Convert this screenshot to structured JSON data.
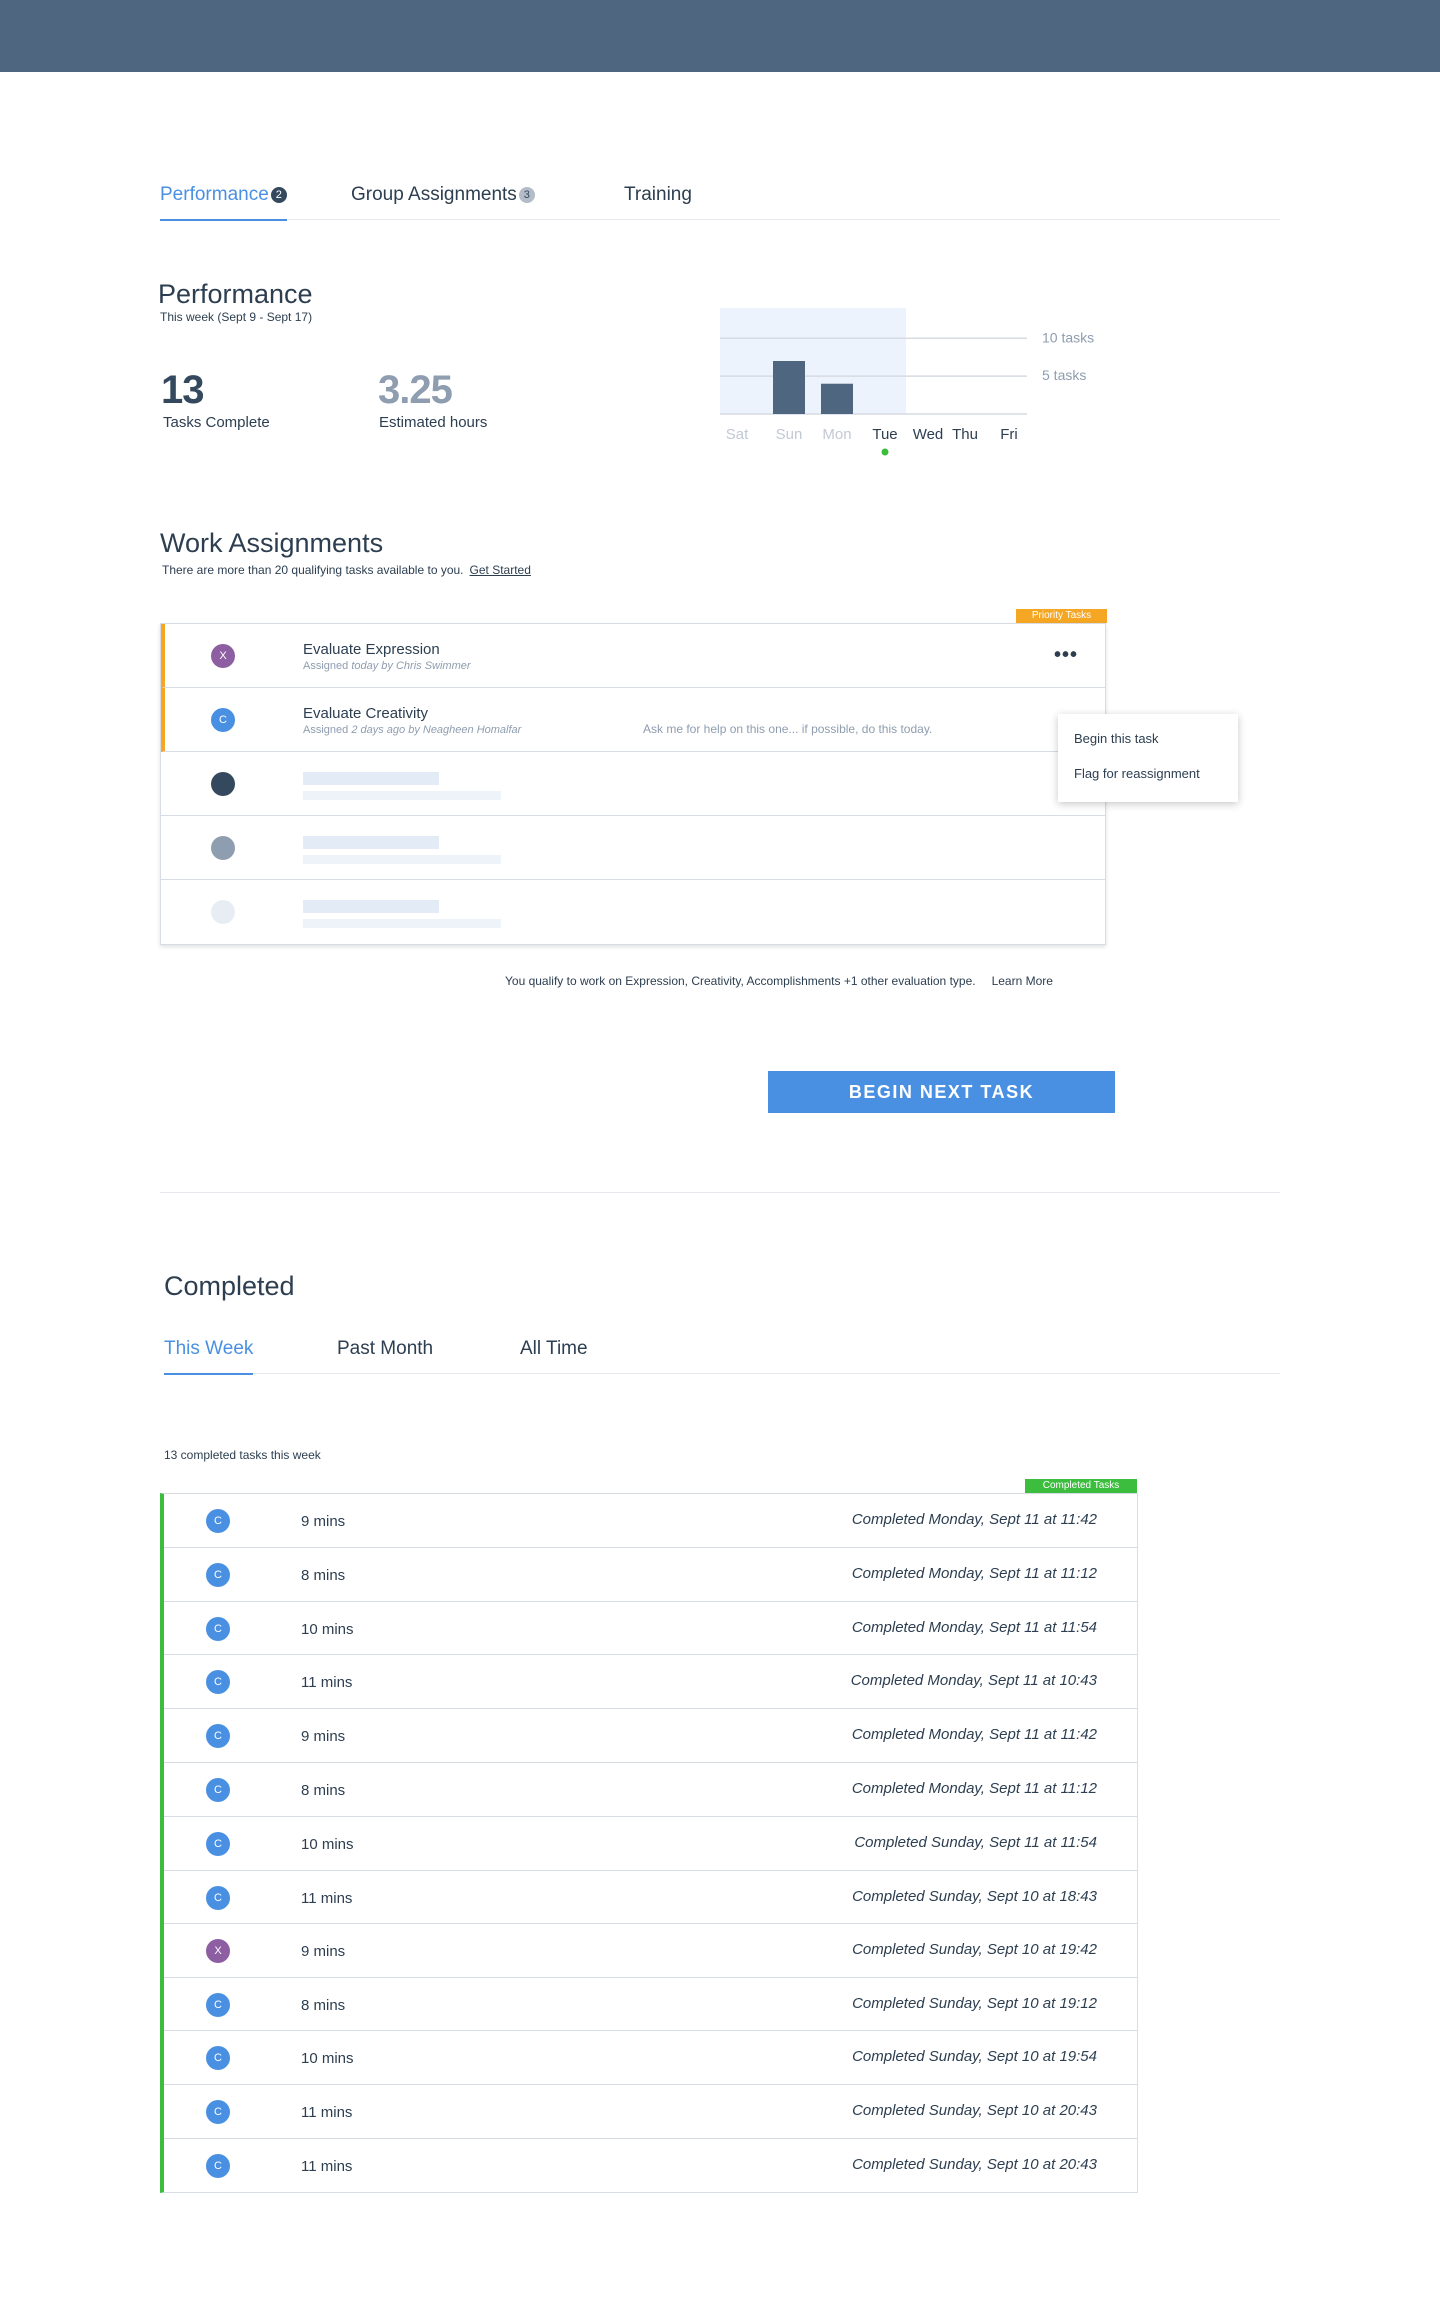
{
  "tabs": {
    "performance": {
      "label": "Performance",
      "badge": "2"
    },
    "group": {
      "label": "Group Assignments",
      "badge": "3"
    },
    "training": {
      "label": "Training"
    }
  },
  "performance": {
    "title": "Performance",
    "subtitle": "This week (Sept 9 - Sept 17)",
    "stats": {
      "tasks_complete": {
        "value": "13",
        "label": "Tasks Complete"
      },
      "estimated_hours": {
        "value": "3.25",
        "label": "Estimated hours"
      }
    }
  },
  "chart_data": {
    "type": "bar",
    "categories": [
      "Sat",
      "Sun",
      "Mon",
      "Tue",
      "Wed",
      "Thu",
      "Fri"
    ],
    "values": [
      0,
      7,
      4,
      0,
      0,
      0,
      0
    ],
    "current_day": "Tue",
    "gridlines": [
      {
        "value": 10,
        "label": "10 tasks"
      },
      {
        "value": 5,
        "label": "5 tasks"
      }
    ],
    "ylim": [
      0,
      14
    ],
    "highlight_range": [
      "Sat",
      "Mon"
    ],
    "colors": {
      "bar": "#4f6680",
      "highlight": "#edf3fd",
      "current_dot": "#3dbd3d"
    }
  },
  "work": {
    "title": "Work Assignments",
    "subtitle": "There are more than 20 qualifying tasks available to you.",
    "get_started": "Get Started",
    "priority_tag": "Priority Tasks",
    "tasks": [
      {
        "initial": "X",
        "name": "Evaluate Expression",
        "meta_prefix": "Assigned ",
        "meta_when": "today",
        "meta_by": " by Chris Swimmer",
        "note": ""
      },
      {
        "initial": "C",
        "name": "Evaluate Creativity",
        "meta_prefix": "Assigned ",
        "meta_when": "2 days ago",
        "meta_by": " by Neagheen Homalfar",
        "note": "Ask me for help on this one... if possible, do this today."
      }
    ],
    "menu": {
      "begin": "Begin this task",
      "flag": "Flag for reassignment"
    },
    "qualify_text": "You qualify to work on Expression, Creativity, Accomplishments +1 other evaluation type.",
    "learn_more": "Learn More",
    "begin_next": "BEGIN NEXT TASK"
  },
  "completed": {
    "title": "Completed",
    "tabs": [
      "This Week",
      "Past  Month",
      "All Time"
    ],
    "count_text": "13 completed tasks this week",
    "tag": "Completed Tasks",
    "rows": [
      {
        "initial": "C",
        "duration": "9 mins",
        "when": "Completed Monday, Sept 11 at 11:42"
      },
      {
        "initial": "C",
        "duration": "8 mins",
        "when": "Completed Monday, Sept 11 at 11:12"
      },
      {
        "initial": "C",
        "duration": "10 mins",
        "when": "Completed Monday, Sept 11 at 11:54"
      },
      {
        "initial": "C",
        "duration": "11 mins",
        "when": "Completed Monday, Sept 11 at 10:43"
      },
      {
        "initial": "C",
        "duration": "9 mins",
        "when": "Completed Monday, Sept 11 at 11:42"
      },
      {
        "initial": "C",
        "duration": "8 mins",
        "when": "Completed Monday, Sept 11 at 11:12"
      },
      {
        "initial": "C",
        "duration": "10 mins",
        "when": "Completed Sunday, Sept 11 at 11:54"
      },
      {
        "initial": "C",
        "duration": "11 mins",
        "when": "Completed Sunday, Sept 10 at 18:43"
      },
      {
        "initial": "X",
        "duration": "9 mins",
        "when": "Completed Sunday, Sept 10 at 19:42"
      },
      {
        "initial": "C",
        "duration": "8 mins",
        "when": "Completed Sunday, Sept 10 at 19:12"
      },
      {
        "initial": "C",
        "duration": "10 mins",
        "when": "Completed Sunday, Sept 10 at 19:54"
      },
      {
        "initial": "C",
        "duration": "11 mins",
        "when": "Completed Sunday, Sept 10 at 20:43"
      },
      {
        "initial": "C",
        "duration": "11 mins",
        "when": "Completed Sunday, Sept 10 at 20:43"
      }
    ]
  },
  "colors": {
    "topbar": "#4f6680",
    "accent": "#4a90e2",
    "priority": "#f5a623",
    "completed": "#3dbd3d",
    "avatar_x": "#8e5ea2",
    "avatar_c": "#4a90e2"
  }
}
